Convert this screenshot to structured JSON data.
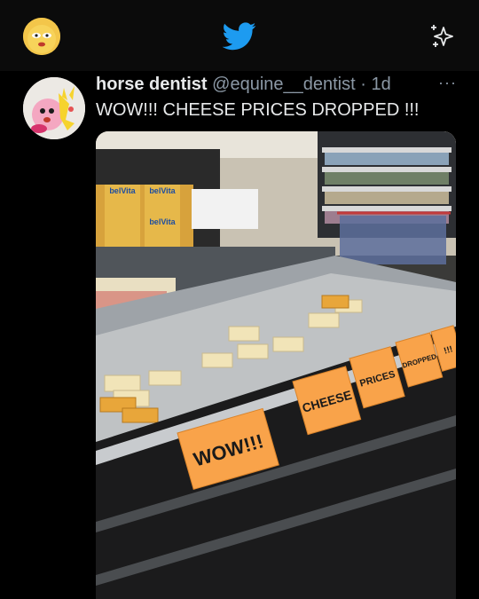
{
  "topbar": {
    "profile_icon": "user-avatar",
    "logo_icon": "bird-logo-icon",
    "sparkle_icon": "sparkle-icon",
    "accent_color": "#1d9bf0"
  },
  "tweet": {
    "author_name": "horse dentist",
    "handle": "@equine__dentist",
    "separator": "·",
    "time": "1d",
    "more_label": "···",
    "text": "WOW!!! CHEESE PRICES DROPPED !!!",
    "media": {
      "signs": {
        "wow": "WOW!!!",
        "cheese": "CHEESE",
        "prices": "PRICES",
        "dropped": "DROPPED",
        "bang": "!!!"
      },
      "box_brand": "belVita",
      "sign_color": "#f9a34a"
    }
  }
}
